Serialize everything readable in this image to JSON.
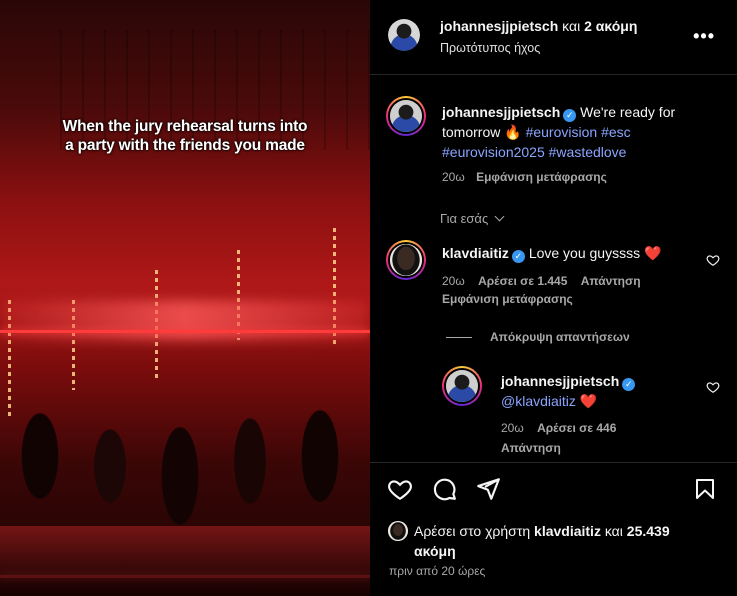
{
  "media": {
    "caption": "When the jury rehearsal turns into a party with the friends you made"
  },
  "header": {
    "username": "johannesjjpietsch",
    "joiner": "και",
    "others": "2 ακόμη",
    "audio": "Πρωτότυπος ήχος",
    "more_icon": "more-horizontal-icon"
  },
  "post": {
    "username": "johannesjjpietsch",
    "caption_text": "We're ready for tomorrow 🔥",
    "hashtags": [
      "#eurovision",
      "#esc",
      "#eurovision2025",
      "#wastedlove"
    ],
    "time": "20ω",
    "translate": "Εμφάνιση μετάφρασης"
  },
  "for_you_label": "Για εσάς",
  "comments": [
    {
      "username": "klavdiaitiz",
      "text": "Love you guyssss ❤️",
      "time": "20ω",
      "likes": "Αρέσει σε 1.445",
      "reply": "Απάντηση",
      "translate": "Εμφάνιση μετάφρασης"
    }
  ],
  "hide_replies": "Απόκρυψη απαντήσεων",
  "replies": [
    {
      "username": "johannesjjpietsch",
      "mention": "@klavdiaitiz",
      "emoji": "❤️",
      "time": "20ω",
      "likes": "Αρέσει σε 446",
      "reply": "Απάντηση"
    }
  ],
  "actions": {
    "like_icon": "heart-icon",
    "comment_icon": "comment-icon",
    "share_icon": "share-icon",
    "save_icon": "bookmark-icon"
  },
  "likes_summary": {
    "prefix": "Αρέσει στο χρήστη",
    "user": "klavdiaitiz",
    "joiner": "και",
    "count": "25.439",
    "suffix": "ακόμη"
  },
  "posted_ago": "πριν από 20 ώρες",
  "colors": {
    "background": "#000000",
    "hashtag": "#8aa5ff",
    "verified": "#3897f0",
    "heart": "#ff3040"
  }
}
